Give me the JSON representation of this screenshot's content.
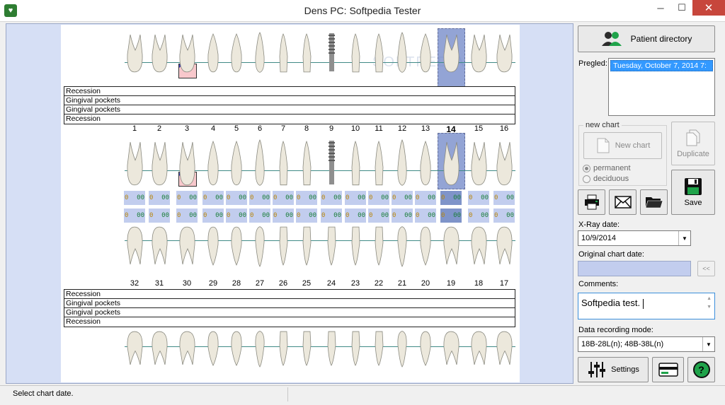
{
  "window": {
    "title": "Dens PC: Softpedia Tester",
    "minimize": "─",
    "maximize": "☐",
    "close": "✕"
  },
  "watermark": "SOFTPEDIA",
  "upper": {
    "numbers": [
      "1",
      "2",
      "3",
      "4",
      "5",
      "6",
      "7",
      "8",
      "9",
      "10",
      "11",
      "12",
      "13",
      "14",
      "15",
      "16"
    ],
    "selected_number": "14",
    "perio_rows": [
      "Recession",
      "Gingival pockets",
      "Gingival pockets",
      "Recession"
    ]
  },
  "lower": {
    "numbers": [
      "32",
      "31",
      "30",
      "29",
      "28",
      "27",
      "26",
      "25",
      "24",
      "23",
      "22",
      "21",
      "20",
      "19",
      "18",
      "17"
    ],
    "perio_rows": [
      "Recession",
      "Gingival pockets",
      "Gingival pockets",
      "Recession"
    ]
  },
  "perio_cell": {
    "left": "0",
    "right": "00"
  },
  "status": {
    "text": "Select chart date."
  },
  "panel": {
    "patient_directory": "Patient directory",
    "pregled_label": "Pregled:",
    "pregled_selected": "Tuesday, October 7, 2014 7:",
    "new_chart_group": "new chart",
    "new_chart_button": "New chart",
    "duplicate_button": "Duplicate",
    "radio_permanent": "permanent",
    "radio_deciduous": "deciduous",
    "save_button": "Save",
    "xray_label": "X-Ray date:",
    "xray_value": "10/9/2014",
    "original_label": "Original chart date:",
    "back_button": "<<",
    "comments_label": "Comments:",
    "comments_value": "Softpedia test.",
    "mode_label": "Data recording mode:",
    "mode_value": "18B-28L(n); 48B-38L(n)",
    "settings_button": "Settings",
    "help_glyph": "?"
  },
  "colors": {
    "selection": "#6f86c8",
    "accent": "#3399ff",
    "cell_bg": "#c2cdee",
    "close": "#c7463c"
  }
}
